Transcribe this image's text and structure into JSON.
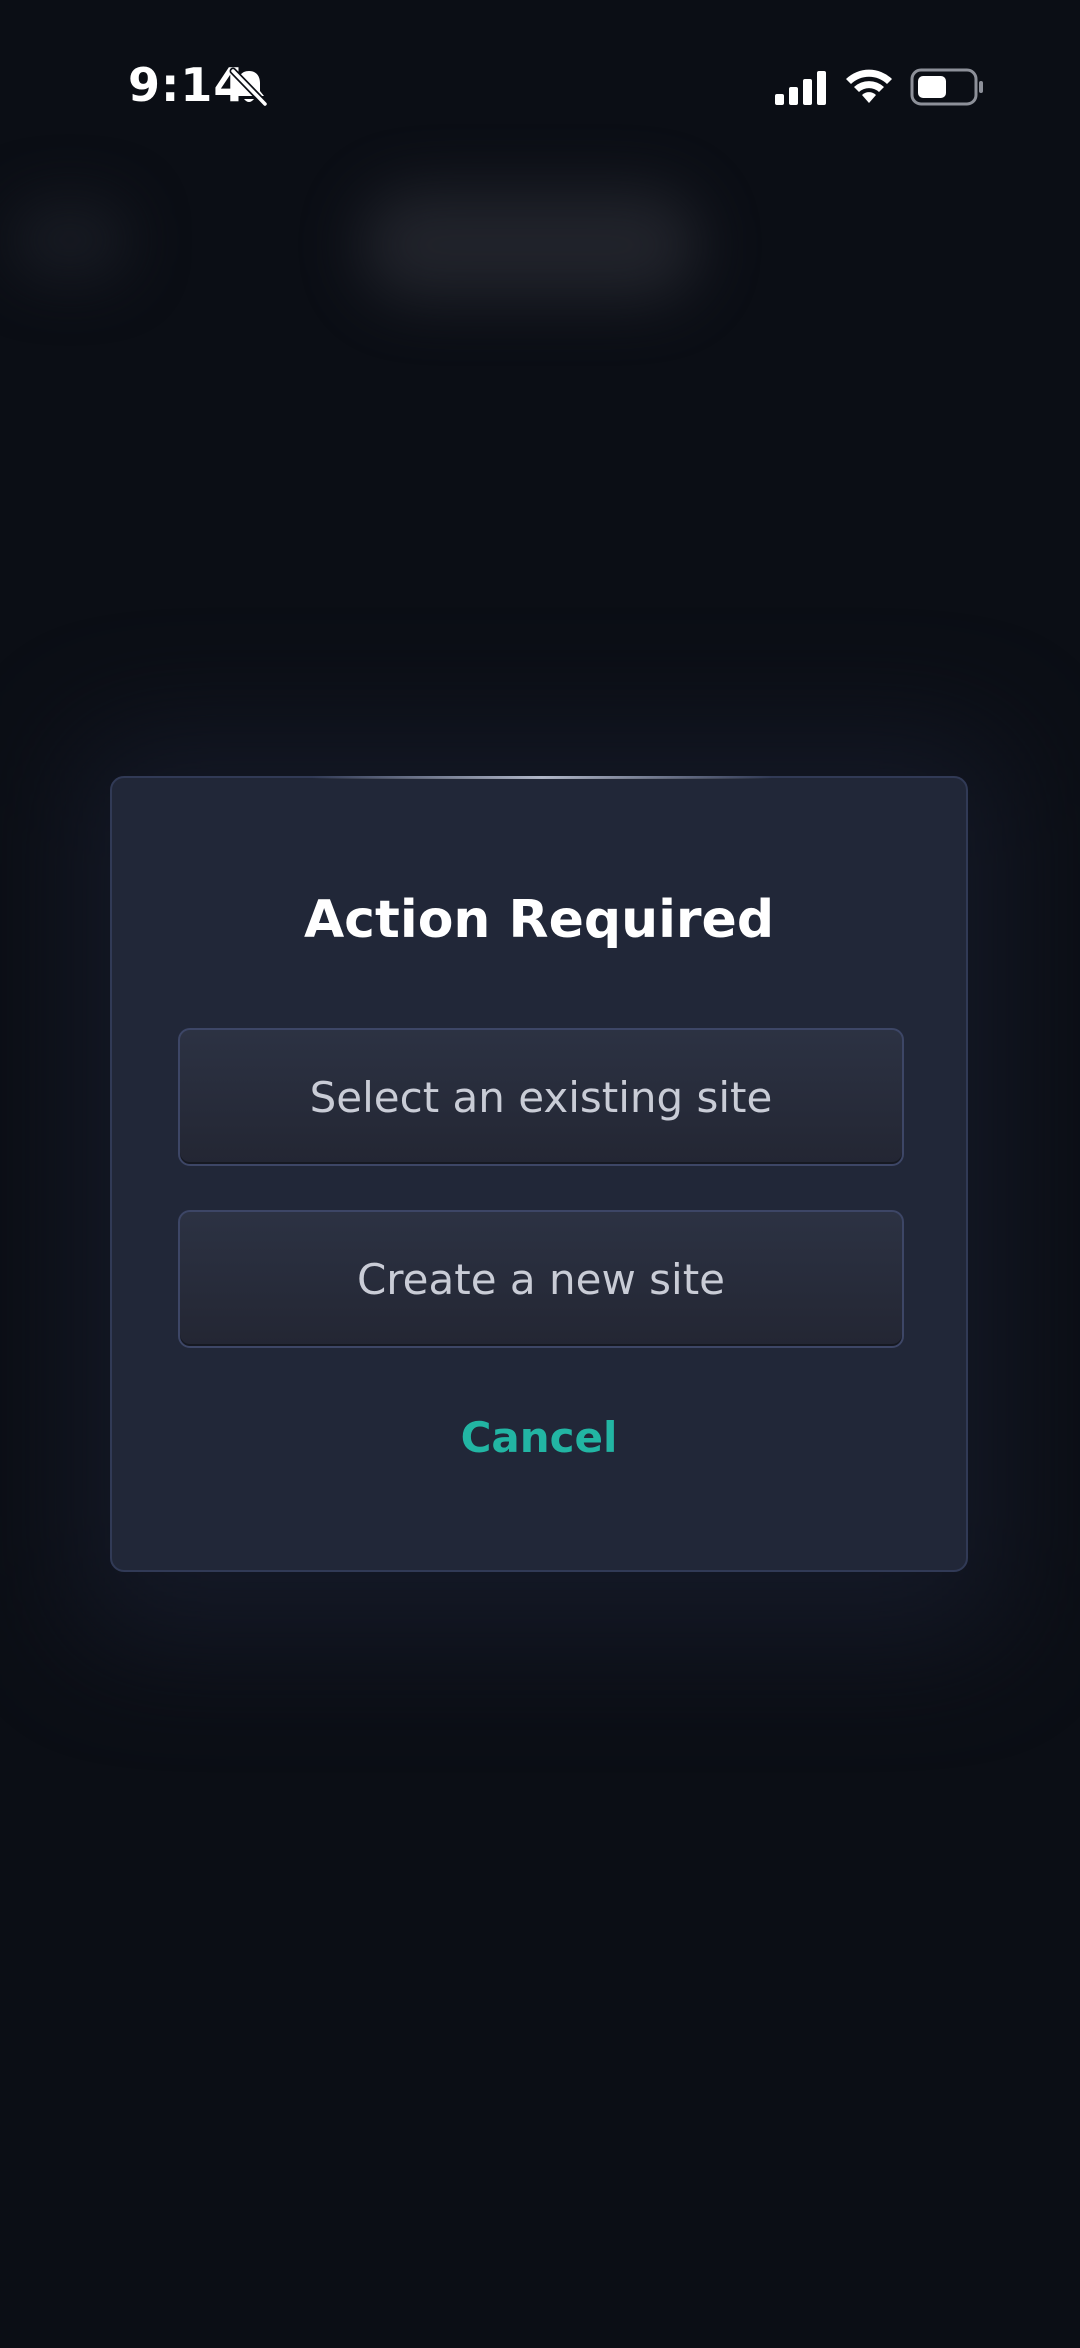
{
  "status_bar": {
    "time": "9:14",
    "icons": [
      "silent-mode-bell-icon",
      "cellular-signal-icon",
      "wifi-icon",
      "battery-icon"
    ],
    "battery_level_fraction": 0.5
  },
  "dialog": {
    "title": "Action Required",
    "options": [
      {
        "label": "Select an existing site"
      },
      {
        "label": "Create a new site"
      }
    ],
    "cancel_label": "Cancel"
  },
  "colors": {
    "background": "#0b0e15",
    "dialog_background": "#212738",
    "dialog_border": "#313a56",
    "button_text": "#c9ccd6",
    "accent": "#22b5a3"
  }
}
